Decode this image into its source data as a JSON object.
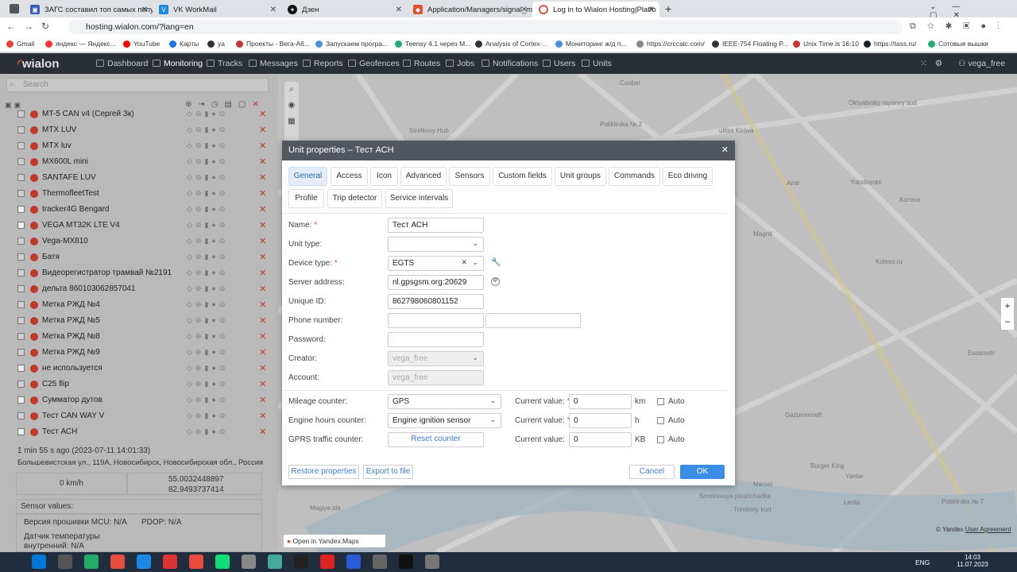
{
  "browser": {
    "tabs": [
      {
        "title": "ЗАГС составил топ самых попу"
      },
      {
        "title": "VK WorkMail"
      },
      {
        "title": "Дзен"
      },
      {
        "title": "Application/Managers/signal_ma"
      },
      {
        "title": "Log in to Wialon Hosting|Platfo"
      }
    ],
    "url": "hosting.wialon.com/?lang=en",
    "bookmarks": [
      "Gmail",
      "яндекс — Яндекс...",
      "YouTube",
      "Карты",
      "ya",
      "Проекты - Вега-А6...",
      "Запускаем програ...",
      "Teensy 4.1 через M...",
      "Analysis of Cortex-...",
      "Мониторинг ж/д п...",
      "https://crccalc.com/",
      "IEEE-754 Floating P...",
      "Unix Time.is 16:10",
      "https://tass.ru/",
      "Сотовые вышки"
    ]
  },
  "app": {
    "logo": "wialon",
    "nav": [
      "Dashboard",
      "Monitoring",
      "Tracks",
      "Messages",
      "Reports",
      "Geofences",
      "Routes",
      "Jobs",
      "Notifications",
      "Users",
      "Units"
    ],
    "user": "vega_free"
  },
  "left": {
    "search_placeholder": "Search",
    "units": [
      "MT-5 CAN v4 (Сергей Зк)",
      "MTX LUV",
      "MTX luv",
      "MX600L mini",
      "SANTAFE LUV",
      "ThermofleetTest",
      "tracker4G Bengard",
      "VEGA MT32K LTE V4",
      "Vega-MX810",
      "Батя",
      "Видеорегистратор трамвай №2191",
      "дельта 860103062857041",
      "Метка РЖД №4",
      "Метка РЖД №5",
      "Метка РЖД №8",
      "Метка РЖД №9",
      "не используется",
      "C25 flip",
      "Сумматор дутов",
      "Тест CAN WAY V",
      "Тест АСН"
    ],
    "last_msg": "1 min 55 s ago (2023-07-11 14:01:33)",
    "address": "Большевистская ул., 119А, Новосибирск, Новосибирская обл., Россия",
    "speed": "0 km/h",
    "lat": "55.0032448897",
    "lon": "82.9493737414",
    "sensor_title": "Sensor values:",
    "sensors": [
      "Версия прошивки MCU: N/A",
      "PDOP: N/A",
      "Датчик температуры внутренний: N/A"
    ]
  },
  "map": {
    "labels": [
      "ulitsa Kirova",
      "Oktyabrsky rayonny sud",
      "Yobidoyobi",
      "Korona",
      "Magnit",
      "Koleso.ru",
      "Esosmotr",
      "Gazpromneft",
      "Burger King",
      "Yantar",
      "Lenta",
      "Marsel",
      "Magiya ida",
      "Poliklinika № 2",
      "Poliklinika № 7",
      "Smotrovaya ploshchadka",
      "Trimlinny kort",
      "Strelkovy Hub",
      "Coober",
      "Amir"
    ],
    "open_link": "Open in Yandex.Maps",
    "copyright": "© Yandex",
    "agreement": "User Agreement"
  },
  "modal": {
    "title": "Unit properties – Тест АСН",
    "tabs": [
      "General",
      "Access",
      "Icon",
      "Advanced",
      "Sensors",
      "Custom fields",
      "Unit groups",
      "Commands",
      "Eco driving",
      "Profile",
      "Trip detector",
      "Service intervals"
    ],
    "fields": {
      "name_label": "Name:",
      "name": "Тест АСН",
      "unit_type_label": "Unit type:",
      "device_type_label": "Device type:",
      "device_type": "EGTS",
      "server_label": "Server address:",
      "server": "nl.gpsgsm.org:20629",
      "uid_label": "Unique ID:",
      "uid": "862798060801152",
      "phone_label": "Phone number:",
      "password_label": "Password:",
      "creator_label": "Creator:",
      "creator": "vega_free",
      "account_label": "Account:",
      "account": "vega_free"
    },
    "counters": {
      "mileage_label": "Mileage counter:",
      "mileage": "GPS",
      "engine_label": "Engine hours counter:",
      "engine": "Engine ignition sensor",
      "gprs_label": "GPRS traffic counter:",
      "reset": "Reset counter",
      "current_label": "Current value:",
      "mileage_value": "0",
      "engine_value": "0",
      "gprs_value": "0",
      "unit_km": "km",
      "unit_h": "h",
      "unit_kb": "KB",
      "auto": "Auto"
    },
    "buttons": {
      "restore": "Restore properties",
      "export": "Export to file",
      "cancel": "Cancel",
      "ok": "OK"
    }
  },
  "taskbar": {
    "lang": "ENG",
    "time": "14:03",
    "date": "11.07.2023"
  },
  "colors": {
    "accent": "#3a8ee6",
    "nav_bg": "#2a2e35",
    "danger": "#c0392b"
  }
}
